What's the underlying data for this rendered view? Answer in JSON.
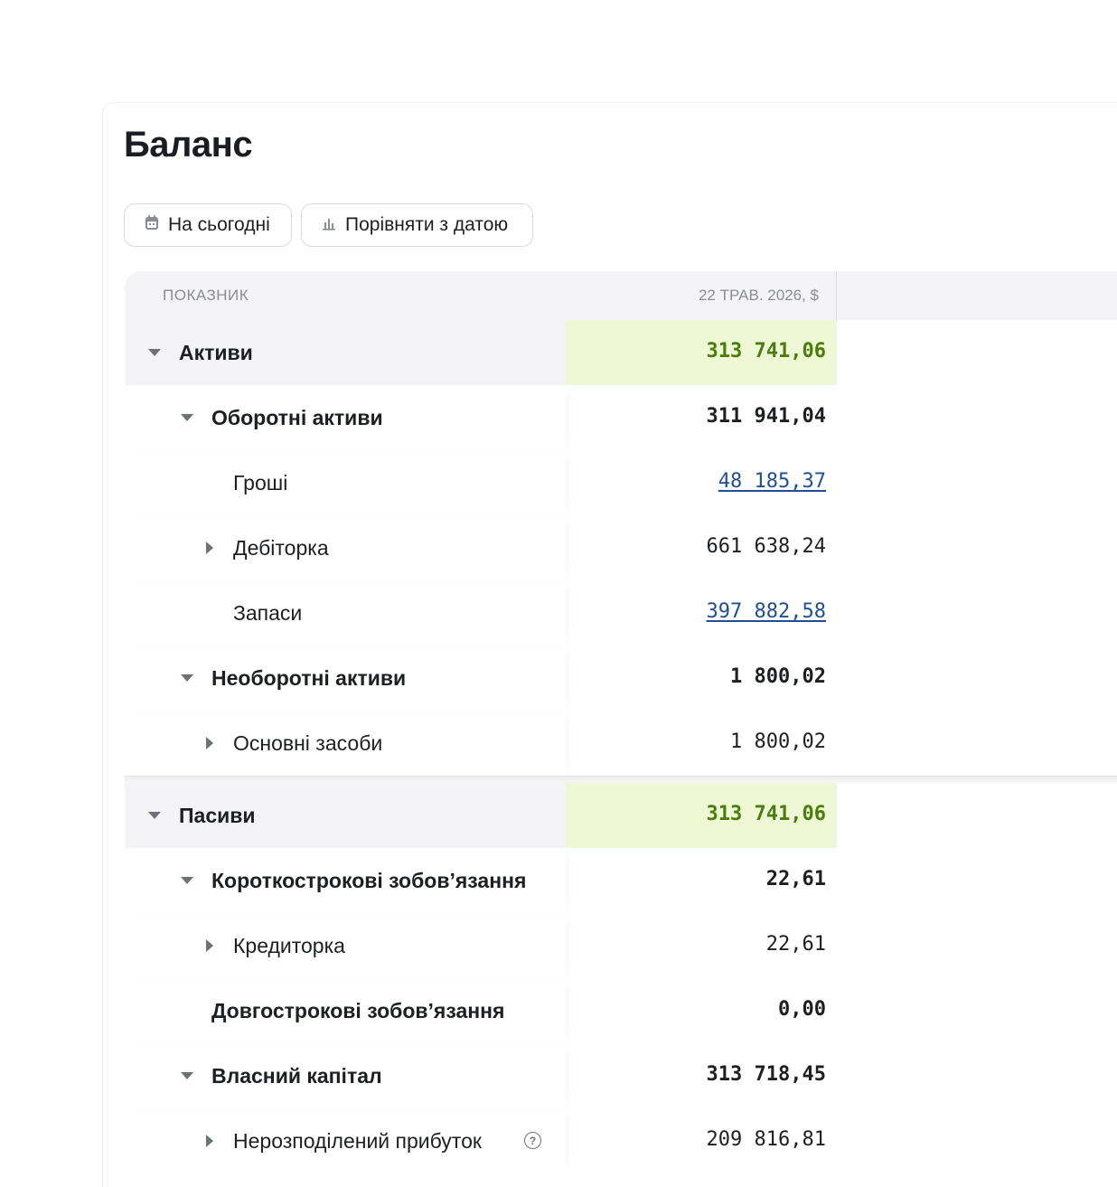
{
  "page": {
    "title": "Баланс"
  },
  "toolbar": {
    "today_label": "На сьогодні",
    "today_icon": "calendar-icon",
    "compare_label": "Порівняти з датою",
    "compare_icon": "bar-chart-icon"
  },
  "table": {
    "header": {
      "indicator": "ПОКАЗНИК",
      "date_column": "22 ТРАВ. 2026, $"
    },
    "rows": [
      {
        "label": "Активи",
        "value": "313 741,06",
        "level": 0,
        "style": "section",
        "expand": "down"
      },
      {
        "label": "Оборотні активи",
        "value": "311 941,04",
        "level": 1,
        "style": "bold",
        "expand": "down"
      },
      {
        "label": "Гроші",
        "value": "48 185,37",
        "level": 2,
        "style": "link",
        "expand": "none"
      },
      {
        "label": "Дебіторка",
        "value": "661 638,24",
        "level": 2,
        "style": "plain",
        "expand": "right"
      },
      {
        "label": "Запаси",
        "value": "397 882,58",
        "level": 2,
        "style": "link",
        "expand": "none"
      },
      {
        "label": "Необоротні активи",
        "value": "1 800,02",
        "level": 1,
        "style": "bold",
        "expand": "down"
      },
      {
        "label": "Основні засоби",
        "value": "1 800,02",
        "level": 2,
        "style": "plain",
        "expand": "right"
      },
      {
        "label": "Пасиви",
        "value": "313 741,06",
        "level": 0,
        "style": "section",
        "expand": "down"
      },
      {
        "label": "Короткострокові зобов’язання",
        "value": "22,61",
        "level": 1,
        "style": "bold",
        "expand": "down"
      },
      {
        "label": "Кредиторка",
        "value": "22,61",
        "level": 2,
        "style": "plain",
        "expand": "right"
      },
      {
        "label": "Довгострокові зобов’язання",
        "value": "0,00",
        "level": 1,
        "style": "bold",
        "expand": "none"
      },
      {
        "label": "Власний капітал",
        "value": "313 718,45",
        "level": 1,
        "style": "bold",
        "expand": "down"
      },
      {
        "label": "Нерозподілений прибуток",
        "value": "209 816,81",
        "level": 2,
        "style": "plain",
        "expand": "right",
        "help_icon": "question-circle-icon"
      }
    ]
  },
  "colors": {
    "section_highlight": "#eef8d5",
    "section_value": "#4a7d0b",
    "link": "#1f4f96"
  }
}
